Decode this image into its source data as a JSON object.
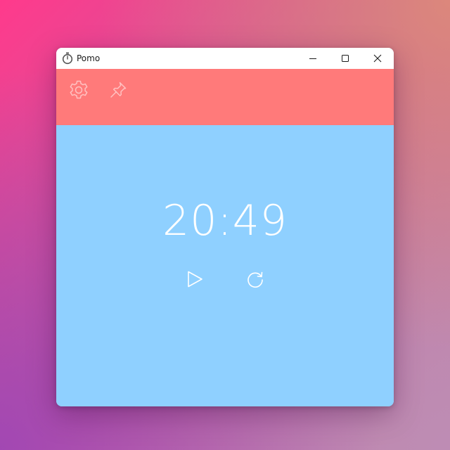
{
  "window": {
    "title": "Pomo",
    "app_icon": "stopwatch-icon",
    "controls": [
      "minimize-icon",
      "maximize-icon",
      "close-icon"
    ]
  },
  "toolbar": {
    "background": "#ff7a7a",
    "icons": [
      "gear-icon",
      "pin-icon"
    ]
  },
  "timer": {
    "time": "20:49",
    "background": "#8fd0ff",
    "controls": [
      "play-icon",
      "reset-icon"
    ]
  }
}
